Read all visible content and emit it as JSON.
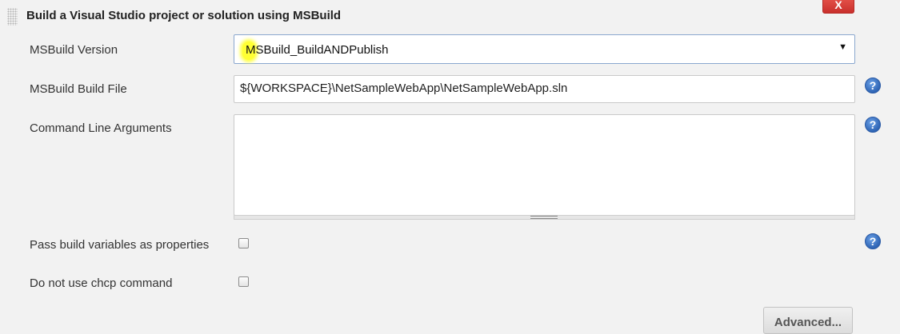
{
  "header": {
    "title": "Build a Visual Studio project or solution using MSBuild",
    "close_label": "X"
  },
  "fields": {
    "version": {
      "label": "MSBuild Version",
      "selected": "MSBuild_BuildANDPublish",
      "arrow": "▼"
    },
    "build_file": {
      "label": "MSBuild Build File",
      "value": "${WORKSPACE}\\NetSampleWebApp\\NetSampleWebApp.sln"
    },
    "args": {
      "label": "Command Line Arguments",
      "value": ""
    },
    "pass_vars": {
      "label": "Pass build variables as properties",
      "checked": false
    },
    "no_chcp": {
      "label": "Do not use chcp command",
      "checked": false
    }
  },
  "help": {
    "glyph": "?"
  },
  "advanced_label": "Advanced...",
  "colors": {
    "highlight": "#ffff33",
    "close": "#d9534f",
    "help": "#3d76c8"
  }
}
